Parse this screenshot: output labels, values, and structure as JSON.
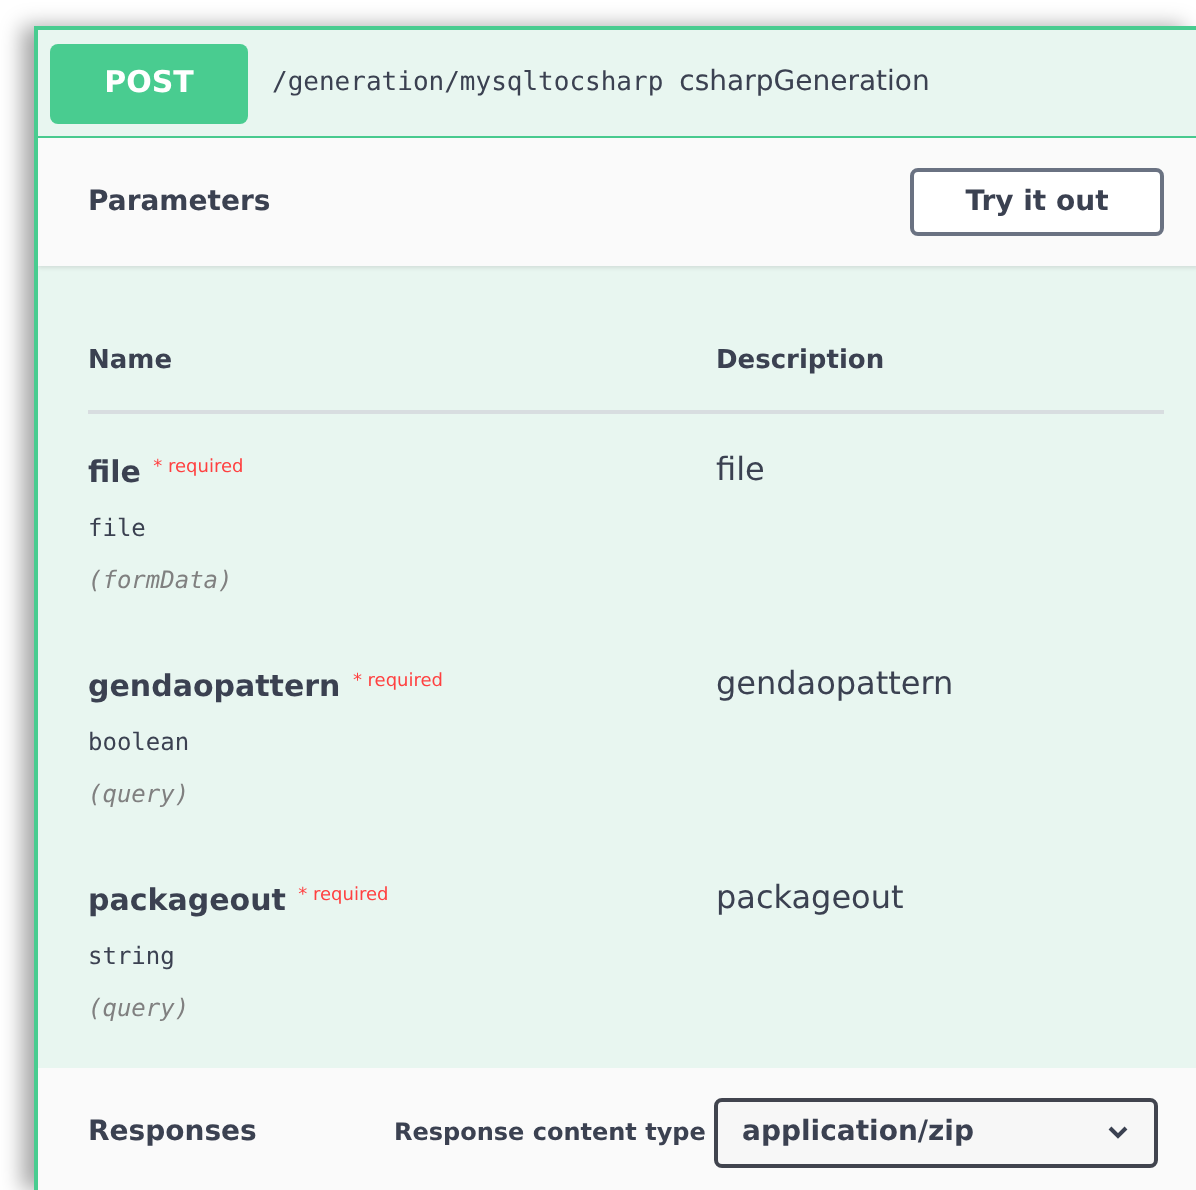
{
  "operation": {
    "method": "POST",
    "path": "/generation/mysqltocsharp",
    "summary": "csharpGeneration"
  },
  "parameters_section": {
    "title": "Parameters",
    "try_button": "Try it out"
  },
  "table": {
    "columns": [
      "Name",
      "Description"
    ],
    "rows": [
      {
        "name": "file $^{* required}$",
        "type": "file",
        "location": "(formData)",
        "description": "file"
      },
      {
        "name": "gendaopattern $^{* required}$",
        "type": "boolean",
        "location": "(query)",
        "description": "gendaopattern"
      },
      {
        "name": "packageout $^{* required}$",
        "type": "string",
        "location": "(query)",
        "description": "packageout"
      }
    ]
  },
  "responses": {
    "title": "Responses",
    "content_type_label": "Response content type",
    "content_type": "application/zip"
  }
}
